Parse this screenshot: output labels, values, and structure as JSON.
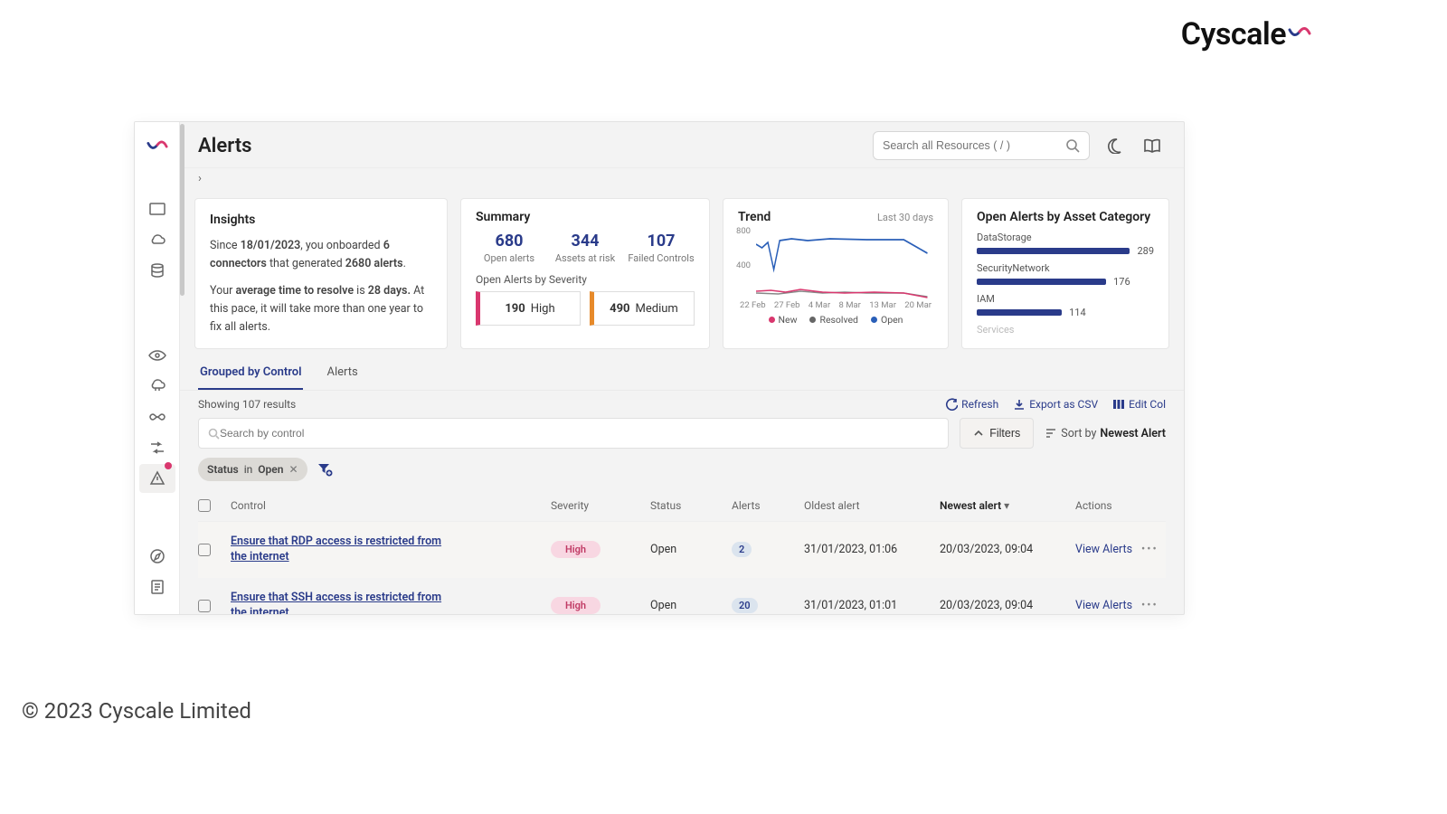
{
  "brand": "Cyscale",
  "copyright": "© 2023 Cyscale Limited",
  "header": {
    "title": "Alerts",
    "search_placeholder": "Search all Resources ( / )"
  },
  "breadcrumb_chevron": "›",
  "insights": {
    "title": "Insights",
    "since_prefix": "Since ",
    "since_date": "18/01/2023",
    "onboard_mid": ", you onboarded ",
    "connectors": "6 connectors",
    "gen_mid": " that generated ",
    "alerts_count": "2680 alerts",
    "tail1": ".",
    "line2_pre": "Your ",
    "avg_label": "average time to resolve",
    "line2_mid": " is ",
    "days": "28 days.",
    "line2_tail": " At this pace, it will take more than one year to fix all alerts."
  },
  "summary": {
    "title": "Summary",
    "open_val": "680",
    "open_lbl": "Open alerts",
    "risk_val": "344",
    "risk_lbl": "Assets at risk",
    "fail_val": "107",
    "fail_lbl": "Failed Controls",
    "sev_title": "Open Alerts by Severity",
    "high_val": "190",
    "high_lbl": "High",
    "med_val": "490",
    "med_lbl": "Medium"
  },
  "trend": {
    "title": "Trend",
    "range": "Last 30 days",
    "y_top": "800",
    "y_mid": "400",
    "xticks": [
      "22 Feb",
      "27 Feb",
      "4 Mar",
      "8 Mar",
      "13 Mar",
      "20 Mar"
    ],
    "legend": {
      "new": "New",
      "resolved": "Resolved",
      "open": "Open"
    }
  },
  "byasset": {
    "title": "Open Alerts by Asset Category",
    "rows": [
      {
        "name": "DataStorage",
        "val": 289,
        "pct": 100
      },
      {
        "name": "SecurityNetwork",
        "val": 176,
        "pct": 73
      },
      {
        "name": "IAM",
        "val": 114,
        "pct": 48
      }
    ],
    "more": "Services"
  },
  "tabs": {
    "grouped": "Grouped by Control",
    "alerts": "Alerts"
  },
  "toolbar": {
    "count": "Showing 107 results",
    "refresh": "Refresh",
    "export": "Export as CSV",
    "edit_cols": "Edit Col"
  },
  "search_control_placeholder": "Search by control",
  "filters_btn": "Filters",
  "sort_prefix": "Sort by ",
  "sort_value": "Newest Alert",
  "chip": {
    "field": "Status",
    "mid": " in ",
    "value": "Open"
  },
  "columns": {
    "control": "Control",
    "severity": "Severity",
    "status": "Status",
    "alerts": "Alerts",
    "oldest": "Oldest alert",
    "newest": "Newest alert",
    "actions": "Actions"
  },
  "sort_arrow": "▾",
  "rows": [
    {
      "control": "Ensure that RDP access is restricted from the internet",
      "severity": "High",
      "status": "Open",
      "alerts": "2",
      "oldest": "31/01/2023, 01:06",
      "newest": "20/03/2023, 09:04",
      "action": "View Alerts"
    },
    {
      "control": "Ensure that SSH access is restricted from the internet",
      "severity": "High",
      "status": "Open",
      "alerts": "20",
      "oldest": "31/01/2023, 01:01",
      "newest": "20/03/2023, 09:04",
      "action": "View Alerts"
    }
  ],
  "chart_data": {
    "trend": {
      "type": "line",
      "x_ticks": [
        "22 Feb",
        "27 Feb",
        "4 Mar",
        "8 Mar",
        "13 Mar",
        "20 Mar"
      ],
      "ylim": [
        0,
        900
      ],
      "series": [
        {
          "name": "Open",
          "color": "#2a5fb8",
          "values": [
            620,
            580,
            640,
            420,
            660,
            680,
            685,
            670,
            680,
            680,
            670,
            680,
            680,
            680,
            680,
            680,
            680,
            680,
            680,
            680,
            680,
            680,
            680,
            680,
            680,
            680,
            680,
            560
          ]
        },
        {
          "name": "Resolved",
          "color": "#666666",
          "values": [
            40,
            30,
            50,
            20,
            35,
            30,
            28,
            30,
            30,
            30,
            30,
            30,
            30,
            30,
            30,
            30,
            30,
            30,
            30,
            30,
            30,
            30,
            30,
            30,
            30,
            30,
            30,
            10
          ]
        },
        {
          "name": "New",
          "color": "#d9376e",
          "values": [
            60,
            50,
            55,
            70,
            40,
            45,
            42,
            40,
            38,
            40,
            40,
            40,
            40,
            40,
            40,
            40,
            40,
            40,
            40,
            40,
            40,
            40,
            40,
            40,
            40,
            40,
            40,
            5
          ]
        }
      ]
    },
    "open_by_asset": {
      "type": "bar",
      "orientation": "horizontal",
      "categories": [
        "DataStorage",
        "SecurityNetwork",
        "IAM"
      ],
      "values": [
        289,
        176,
        114
      ]
    },
    "open_by_severity": {
      "type": "bar",
      "categories": [
        "High",
        "Medium"
      ],
      "values": [
        190,
        490
      ]
    }
  }
}
